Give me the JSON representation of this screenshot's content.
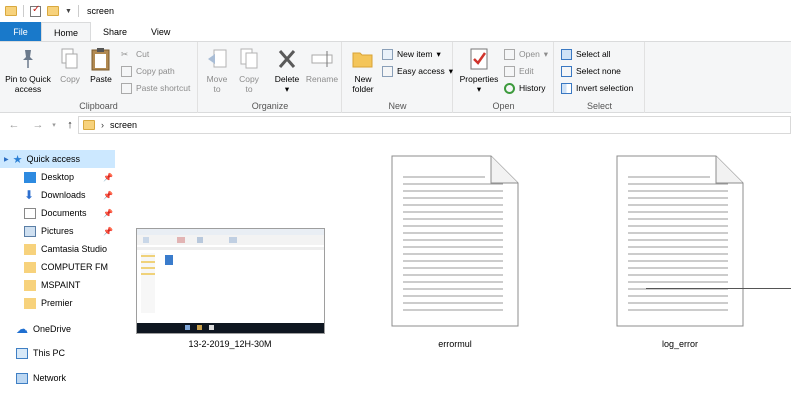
{
  "window": {
    "title": "screen"
  },
  "tabs": [
    {
      "label": "File"
    },
    {
      "label": "Home"
    },
    {
      "label": "Share"
    },
    {
      "label": "View"
    }
  ],
  "ribbon": {
    "clipboard": {
      "label": "Clipboard",
      "pin": "Pin to Quick access",
      "pin_line1": "Pin to Quick",
      "pin_line2": "access",
      "copy": "Copy",
      "paste": "Paste",
      "cut": "Cut",
      "copy_path": "Copy path",
      "paste_shortcut": "Paste shortcut"
    },
    "organize": {
      "label": "Organize",
      "move_to_1": "Move",
      "move_to_2": "to",
      "copy_to_1": "Copy",
      "copy_to_2": "to",
      "delete": "Delete",
      "rename": "Rename"
    },
    "new": {
      "label": "New",
      "new_folder_1": "New",
      "new_folder_2": "folder",
      "new_item": "New item",
      "easy_access": "Easy access"
    },
    "open": {
      "label": "Open",
      "properties": "Properties",
      "open": "Open",
      "edit": "Edit",
      "history": "History"
    },
    "select": {
      "label": "Select",
      "select_all": "Select all",
      "select_none": "Select none",
      "invert_selection": "Invert selection"
    }
  },
  "address": {
    "crumb": "screen"
  },
  "nav": {
    "quick_access": "Quick access",
    "items": [
      {
        "label": "Desktop",
        "pinned": true
      },
      {
        "label": "Downloads",
        "pinned": true
      },
      {
        "label": "Documents",
        "pinned": true
      },
      {
        "label": "Pictures",
        "pinned": true
      },
      {
        "label": "Camtasia Studio",
        "pinned": false
      },
      {
        "label": "COMPUTER FM",
        "pinned": false
      },
      {
        "label": "MSPAINT",
        "pinned": false
      },
      {
        "label": "Premier",
        "pinned": false
      }
    ],
    "onedrive": "OneDrive",
    "thispc": "This PC",
    "network": "Network"
  },
  "files": [
    {
      "name": "13-2-2019_12H-30M",
      "kind": "image"
    },
    {
      "name": "errormul",
      "kind": "text"
    },
    {
      "name": "log_error",
      "kind": "text"
    }
  ],
  "colors": {
    "accent": "#1979ca",
    "selection": "#cce8ff",
    "folder": "#f7d27c"
  }
}
